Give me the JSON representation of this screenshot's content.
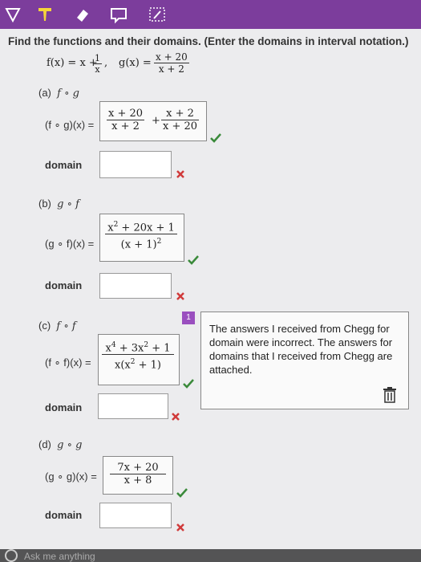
{
  "prompt": "Find the functions and their domains. (Enter the domains in interval notation.)",
  "given": {
    "f_lhs": "f(x) = x +",
    "f_num": "1",
    "f_den": "x",
    "sep": ",",
    "g_lhs": "g(x) =",
    "g_num": "x + 20",
    "g_den": "x + 2"
  },
  "parts": [
    {
      "label": "(a)",
      "comp": "f ∘ g",
      "lhs": "(f ∘ g)(x) =",
      "answer": {
        "t1_num": "x + 20",
        "t1_den": "x + 2",
        "op": "+",
        "t2_num": "x + 2",
        "t2_den": "x + 20"
      },
      "domain_label": "domain",
      "answer_correct": true,
      "domain_correct": false
    },
    {
      "label": "(b)",
      "comp": "g ∘ f",
      "lhs": "(g ∘ f)(x) =",
      "answer": {
        "num_a": "x",
        "num_sup": "2",
        "num_b": " + 20x + 1",
        "den_a": "(x + 1)",
        "den_sup": "2"
      },
      "domain_label": "domain",
      "answer_correct": true,
      "domain_correct": false
    },
    {
      "label": "(c)",
      "comp": "f ∘ f",
      "lhs": "(f ∘ f)(x) =",
      "answer": {
        "num_a": "x",
        "num_sup1": "4",
        "num_b": " + 3x",
        "num_sup2": "2",
        "num_c": " + 1",
        "den_a": "x(x",
        "den_sup": "2",
        "den_b": " + 1)"
      },
      "domain_label": "domain",
      "answer_correct": true,
      "domain_correct": false
    },
    {
      "label": "(d)",
      "comp": "g ∘ g",
      "lhs": "(g ∘ g)(x) =",
      "answer": {
        "num": "7x + 20",
        "den": "x + 8"
      },
      "domain_label": "domain",
      "answer_correct": true,
      "domain_correct": false
    }
  ],
  "comment": {
    "badge": "1",
    "text": "The answers I received from Chegg for domain were incorrect. The answers for domains that I received from Chegg are attached."
  },
  "ask_placeholder": "Ask me anything",
  "colors": {
    "toolbar": "#7c3d9c",
    "check": "#3a8a3a",
    "cross": "#d03a3a"
  },
  "icons": [
    "pen-icon",
    "highlighter-icon",
    "eraser-icon",
    "comment-icon",
    "select-icon",
    "trash-icon",
    "check-icon",
    "cross-icon"
  ]
}
